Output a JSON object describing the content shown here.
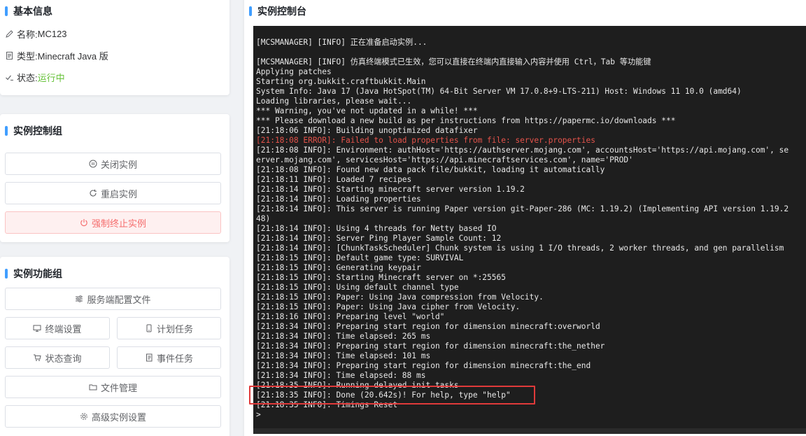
{
  "info": {
    "title": "基本信息",
    "name_label": "名称: ",
    "name_value": "MC123",
    "type_label": "类型: ",
    "type_value": "Minecraft Java 版",
    "status_label": "状态: ",
    "status_value": "运行中"
  },
  "control": {
    "title": "实例控制组",
    "stop": "关闭实例",
    "restart": "重启实例",
    "kill": "强制终止实例"
  },
  "features": {
    "title": "实例功能组",
    "server_config": "服务端配置文件",
    "terminal_settings": "终端设置",
    "scheduled_tasks": "计划任务",
    "status_query": "状态查询",
    "event_tasks": "事件任务",
    "file_management": "文件管理",
    "advanced_settings": "高级实例设置"
  },
  "console": {
    "title": "实例控制台",
    "lines": [
      "[MCSMANAGER] [INFO] 正在准备启动实例...",
      "",
      "[MCSMANAGER] [INFO] 仿真终端模式已生效，您可以直接在终端内直接输入内容并使用 Ctrl，Tab 等功能键",
      "Applying patches",
      "Starting org.bukkit.craftbukkit.Main",
      "System Info: Java 17 (Java HotSpot(TM) 64-Bit Server VM 17.0.8+9-LTS-211) Host: Windows 11 10.0 (amd64)",
      "Loading libraries, please wait...",
      "*** Warning, you've not updated in a while! ***",
      "*** Please download a new build as per instructions from https://papermc.io/downloads ***",
      "[21:18:06 INFO]: Building unoptimized datafixer",
      "[21:18:08 ERROR]: Failed to load properties from file: server.properties",
      "[21:18:08 INFO]: Environment: authHost='https://authserver.mojang.com', accountsHost='https://api.mojang.com', se",
      "erver.mojang.com', servicesHost='https://api.minecraftservices.com', name='PROD'",
      "[21:18:08 INFO]: Found new data pack file/bukkit, loading it automatically",
      "[21:18:11 INFO]: Loaded 7 recipes",
      "[21:18:14 INFO]: Starting minecraft server version 1.19.2",
      "[21:18:14 INFO]: Loading properties",
      "[21:18:14 INFO]: This server is running Paper version git-Paper-286 (MC: 1.19.2) (Implementing API version 1.19.2",
      "48)",
      "[21:18:14 INFO]: Using 4 threads for Netty based IO",
      "[21:18:14 INFO]: Server Ping Player Sample Count: 12",
      "[21:18:14 INFO]: [ChunkTaskScheduler] Chunk system is using 1 I/O threads, 2 worker threads, and gen parallelism",
      "[21:18:15 INFO]: Default game type: SURVIVAL",
      "[21:18:15 INFO]: Generating keypair",
      "[21:18:15 INFO]: Starting Minecraft server on *:25565",
      "[21:18:15 INFO]: Using default channel type",
      "[21:18:15 INFO]: Paper: Using Java compression from Velocity.",
      "[21:18:15 INFO]: Paper: Using Java cipher from Velocity.",
      "[21:18:16 INFO]: Preparing level \"world\"",
      "[21:18:34 INFO]: Preparing start region for dimension minecraft:overworld",
      "[21:18:34 INFO]: Time elapsed: 265 ms",
      "[21:18:34 INFO]: Preparing start region for dimension minecraft:the_nether",
      "[21:18:34 INFO]: Time elapsed: 101 ms",
      "[21:18:34 INFO]: Preparing start region for dimension minecraft:the_end",
      "[21:18:34 INFO]: Time elapsed: 88 ms",
      "[21:18:35 INFO]: Running delayed init tasks",
      "[21:18:35 INFO]: Done (20.642s)! For help, type \"help\"",
      "[21:18:35 INFO]: Timings Reset",
      ">"
    ],
    "error_line_index": 10,
    "highlighted_line_index": 36
  },
  "colors": {
    "accent": "#409eff",
    "running": "#67c23a",
    "danger": "#f56c6c",
    "terminal_bg": "#1e1e1e",
    "error_text": "#e5534b",
    "highlight_border": "#e03a3a"
  }
}
